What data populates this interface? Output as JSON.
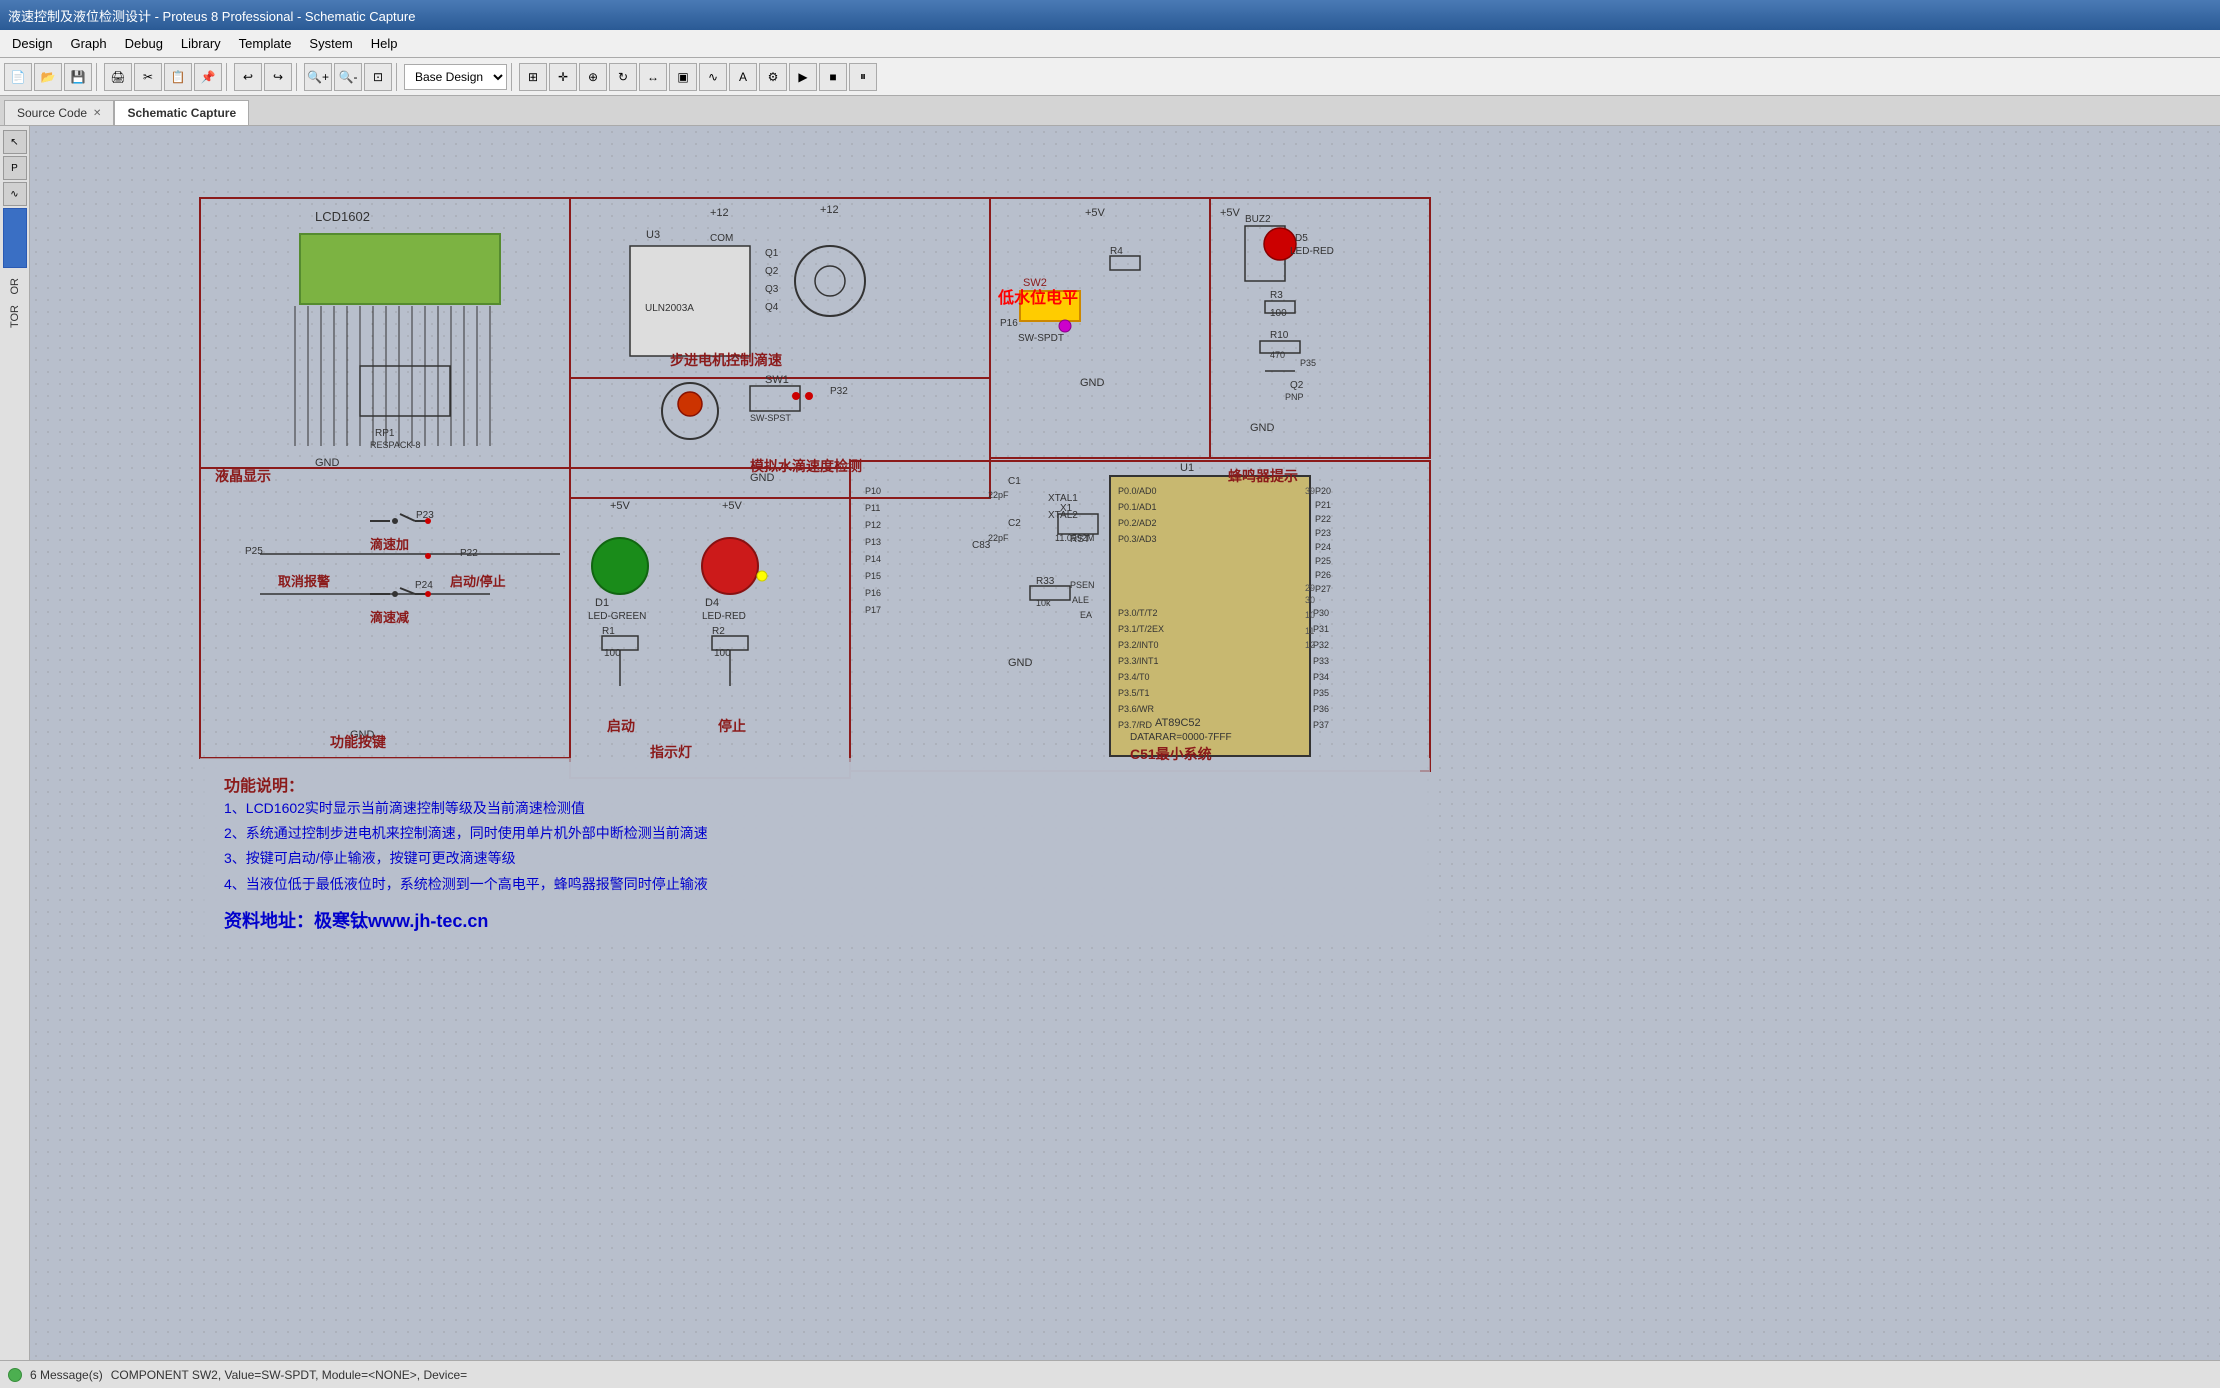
{
  "titlebar": {
    "text": "液速控制及液位检测设计 - Proteus 8 Professional - Schematic Capture"
  },
  "menubar": {
    "items": [
      "Design",
      "Graph",
      "Debug",
      "Library",
      "Template",
      "System",
      "Help"
    ]
  },
  "toolbar": {
    "dropdown_value": "Base Design",
    "dropdown_options": [
      "Base Design"
    ]
  },
  "tabs": [
    {
      "label": "Source Code",
      "active": false,
      "closable": true
    },
    {
      "label": "Schematic Capture",
      "active": true,
      "closable": false
    }
  ],
  "schematic": {
    "panels": [
      {
        "id": "lcd",
        "label": "液晶显示",
        "sub": "LCD1602"
      },
      {
        "id": "stepper",
        "label": "步进电机控制滴速",
        "sub": "U3"
      },
      {
        "id": "waterlevel",
        "label": "低水位电平",
        "sub": ""
      },
      {
        "id": "buzzer",
        "label": "蜂鸣器提示",
        "sub": ""
      },
      {
        "id": "analog",
        "label": "模拟水滴速度检测",
        "sub": "SW1"
      },
      {
        "id": "buttons",
        "label": "功能按键",
        "sub": ""
      },
      {
        "id": "indicator",
        "label": "指示灯",
        "sub": ""
      },
      {
        "id": "c51",
        "label": "C51最小系统",
        "sub": "U1 AT89C52"
      }
    ],
    "button_labels": [
      "取消报警",
      "启动/停止",
      "滴速加",
      "滴速减"
    ],
    "indicator_labels": [
      "启动",
      "停止"
    ],
    "led_labels": [
      "D1 LED-GREEN",
      "D4 LED-RED"
    ],
    "resistor_labels": [
      "R1 100",
      "R2 100"
    ],
    "description": {
      "title": "功能说明：",
      "lines": [
        "1、LCD1602实时显示当前滴速控制等级及当前滴速检测值",
        "2、系统通过控制步进电机来控制滴速，同时使用单片机外部中断检测当前滴速",
        "3、按键可启动/停止输液，按键可更改滴速等级",
        "4、当液位低于最低液位时，系统检测到一个高电平，蜂鸣器报警同时停止输液"
      ],
      "website_label": "资料地址：极寒钛www.jh-tec.cn"
    }
  },
  "statusbar": {
    "message_count": "6 Message(s)",
    "component_info": "COMPONENT SW2, Value=SW-SPDT, Module=<NONE>, Device="
  }
}
